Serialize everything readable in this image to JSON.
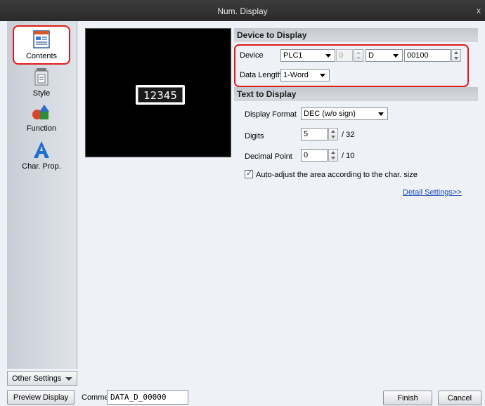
{
  "window": {
    "title": "Num. Display",
    "close": "x"
  },
  "sidebar": {
    "items": [
      {
        "label": "Contents",
        "icon": "contents-icon"
      },
      {
        "label": "Style",
        "icon": "style-icon"
      },
      {
        "label": "Function",
        "icon": "function-icon"
      },
      {
        "label": "Char. Prop.",
        "icon": "char-prop-icon"
      }
    ],
    "other_settings": "Other Settings"
  },
  "preview": {
    "value": "12345"
  },
  "device_section": {
    "header": "Device to Display",
    "device_label": "Device",
    "plc": "PLC1",
    "station": "0",
    "memory": "D",
    "address": "00100",
    "data_length_label": "Data Length",
    "data_length": "1-Word"
  },
  "text_section": {
    "header": "Text to Display",
    "format_label": "Display Format",
    "format": "DEC (w/o sign)",
    "digits_label": "Digits",
    "digits": "5",
    "digits_max": "/ 32",
    "decimal_label": "Decimal Point",
    "decimal": "0",
    "decimal_max": "/ 10",
    "auto_adjust": "Auto-adjust the area according to the char. size",
    "auto_adjust_checked": true,
    "detail_link": "Detail Settings>>"
  },
  "bottom": {
    "preview_button": "Preview Display",
    "comment_label": "Comme",
    "comment": "DATA_D_00000",
    "finish": "Finish",
    "cancel": "Cancel"
  },
  "colors": {
    "highlight": "#e01b1b",
    "link": "#1747b4"
  }
}
